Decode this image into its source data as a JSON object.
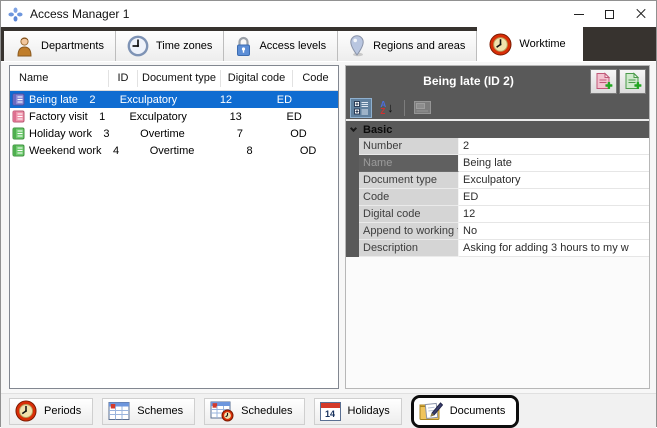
{
  "window": {
    "title": "Access Manager 1"
  },
  "top_tabs": {
    "items": [
      {
        "label": "Departments",
        "icon": "person-icon",
        "active": false
      },
      {
        "label": "Time zones",
        "icon": "clock-icon",
        "active": false
      },
      {
        "label": "Access levels",
        "icon": "padlock-icon",
        "active": false
      },
      {
        "label": "Regions and areas",
        "icon": "map-pin-icon",
        "active": false
      },
      {
        "label": "Worktime",
        "icon": "worktime-clock-icon",
        "active": true
      }
    ]
  },
  "documents_table": {
    "columns": [
      "Name",
      "ID",
      "Document type",
      "Digital code",
      "Code"
    ],
    "rows": [
      {
        "name": "Being late",
        "id": "2",
        "document_type": "Exculpatory",
        "digital_code": "12",
        "code": "ED",
        "icon": "journal-blue-icon",
        "selected": true
      },
      {
        "name": "Factory visit",
        "id": "1",
        "document_type": "Exculpatory",
        "digital_code": "13",
        "code": "ED",
        "icon": "journal-pink-icon",
        "selected": false
      },
      {
        "name": "Holiday work",
        "id": "3",
        "document_type": "Overtime",
        "digital_code": "7",
        "code": "OD",
        "icon": "journal-green-icon",
        "selected": false
      },
      {
        "name": "Weekend work",
        "id": "4",
        "document_type": "Overtime",
        "digital_code": "8",
        "code": "OD",
        "icon": "journal-green-icon",
        "selected": false
      }
    ]
  },
  "detail_panel": {
    "title": "Being late (ID 2)",
    "header_buttons": [
      {
        "name": "add-exculpatory-document-button",
        "icon": "pink-document-plus-icon"
      },
      {
        "name": "add-overtime-document-button",
        "icon": "green-document-plus-icon"
      }
    ],
    "toolbar": [
      {
        "name": "categorized-view-button",
        "selected": true
      },
      {
        "name": "alphabetical-sort-button",
        "selected": false
      },
      {
        "name": "property-pages-button",
        "disabled": true
      }
    ],
    "category": "Basic",
    "properties": [
      {
        "label": "Number",
        "value": "2",
        "selected": false
      },
      {
        "label": "Name",
        "value": "Being late",
        "selected": true
      },
      {
        "label": "Document type",
        "value": "Exculpatory",
        "selected": false
      },
      {
        "label": "Code",
        "value": "ED",
        "selected": false
      },
      {
        "label": "Digital code",
        "value": "12",
        "selected": false
      },
      {
        "label": "Append to working time",
        "value": "No",
        "selected": false
      },
      {
        "label": "Description",
        "value": "Asking for adding 3 hours to my w",
        "selected": false
      }
    ]
  },
  "bottom_tabs": {
    "items": [
      {
        "label": "Periods",
        "icon": "red-clock-icon",
        "highlighted": false
      },
      {
        "label": "Schemes",
        "icon": "calendar-icon",
        "highlighted": false
      },
      {
        "label": "Schedules",
        "icon": "calendar-clock-icon",
        "highlighted": false
      },
      {
        "label": "Holidays",
        "icon": "calendar-date-icon",
        "highlighted": false
      },
      {
        "label": "Documents",
        "icon": "folder-pen-icon",
        "highlighted": true
      }
    ]
  },
  "icons": {
    "az_a": "A",
    "az_z": "Z",
    "az_arrow": "↓",
    "holidays_day": "14"
  },
  "colors": {
    "selection_blue": "#0f6cd1",
    "panel_dark_gray": "#595959",
    "tab_strip_dark": "#37332f",
    "label_cell_gray": "#d5d5d5",
    "highlight_outline_black": "#0d0d0d",
    "worktime_icon_red": "#d92e07"
  }
}
